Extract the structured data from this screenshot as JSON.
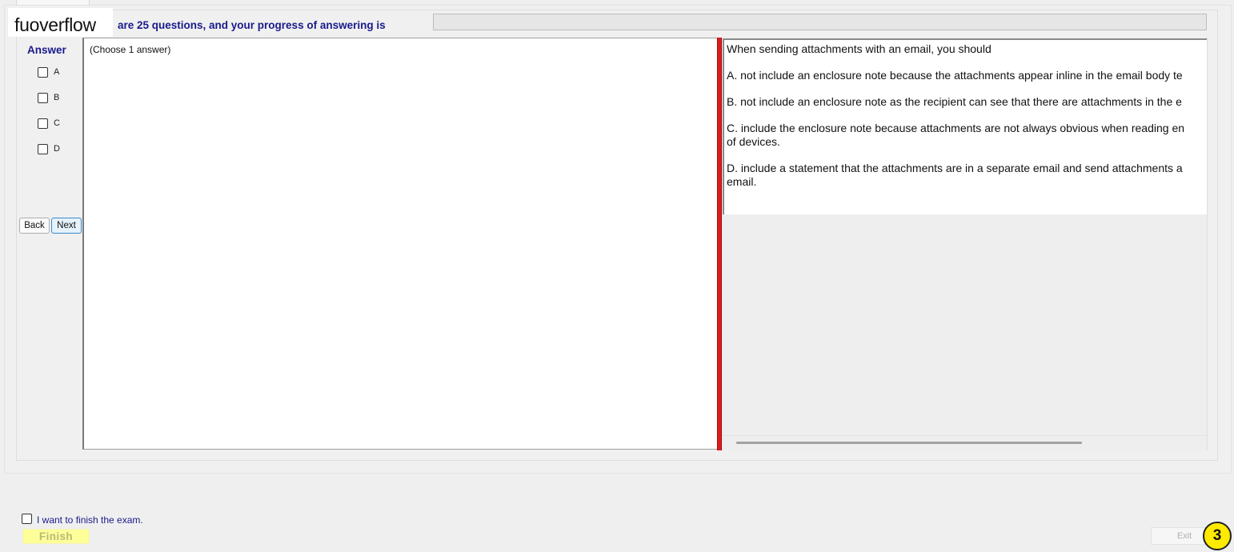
{
  "logo": {
    "text": "fuoverflow"
  },
  "header": {
    "progress_text": "are 25 questions, and your progress of answering is"
  },
  "answer_panel": {
    "heading": "Answer",
    "options": [
      "A",
      "B",
      "C",
      "D"
    ],
    "back_label": "Back",
    "next_label": "Next"
  },
  "choose_panel": {
    "instruction": "(Choose 1 answer)"
  },
  "question": {
    "stem": "When sending attachments with an email, you should",
    "lines": [
      "A.  not include an enclosure note because the attachments appear inline in the email body te",
      "B.  not include an enclosure note as the recipient can see that there are attachments in the e",
      "C.  include the enclosure note because attachments are not always obvious when reading en",
      "of devices.",
      "D.  include a statement that the attachments are in a separate email and send attachments a",
      "email."
    ]
  },
  "footer": {
    "finish_checkbox_label": "I want to finish the exam.",
    "finish_label": "Finish",
    "exit_label": "Exit",
    "step_badge": "3"
  },
  "colors": {
    "accent_text": "#1a1a8c",
    "splitter": "#e01b1b",
    "finish_bg": "#ffff99",
    "badge_bg": "#ffea00"
  }
}
